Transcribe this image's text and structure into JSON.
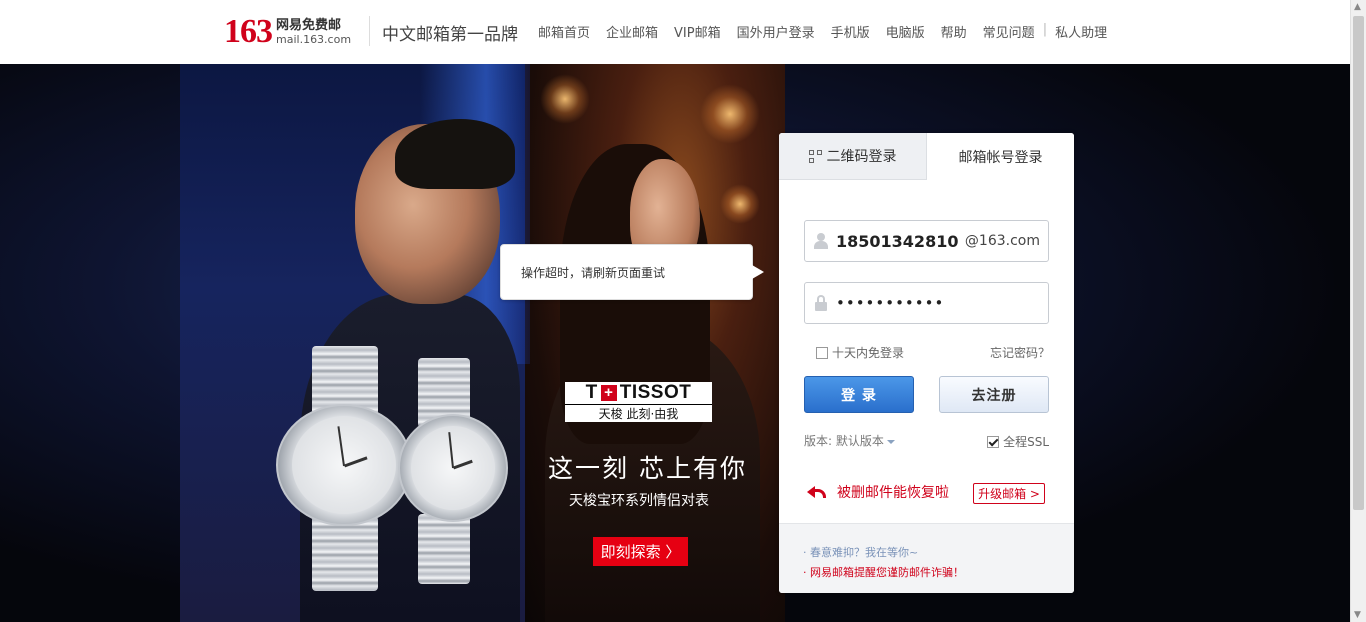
{
  "header": {
    "logo_number": "163",
    "logo_cn": "网易免费邮",
    "logo_en": "mail.163.com",
    "slogan": "中文邮箱第一品牌",
    "nav": [
      "邮箱首页",
      "企业邮箱",
      "VIP邮箱",
      "国外用户登录",
      "手机版",
      "电脑版",
      "帮助",
      "常见问题"
    ],
    "nav_separator": "|",
    "nav_assistant": "私人助理"
  },
  "tooltip": {
    "text": "操作超时，请刷新页面重试"
  },
  "ad": {
    "brand": "TISSOT",
    "brand_letter": "T",
    "brand_cross": "+",
    "brand_tagline": "天梭  此刻·由我",
    "title": "这一刻  芯上有你",
    "subtitle": "天梭宝环系列情侣对表",
    "button": "即刻探索 〉"
  },
  "login": {
    "tab_qr": "二维码登录",
    "tab_account": "邮箱帐号登录",
    "username_value": "18501342810",
    "domain_suffix": "@163.com",
    "password_value": "•••••••••••",
    "remember_label": "十天内免登录",
    "remember_checked": false,
    "forgot_label": "忘记密码？",
    "login_button": "登  录",
    "register_button": "去注册",
    "version_label": "版本: 默认版本",
    "ssl_label": "全程SSL",
    "ssl_checked": true,
    "recover_text": "被删邮件能恢复啦",
    "upgrade_button": "升级邮箱 >",
    "footer_line1": "· 春意难抑？我在等你~",
    "footer_line2": "· 网易邮箱提醒您谨防邮件诈骗！"
  },
  "colors": {
    "brand_red": "#d0021b",
    "login_blue": "#2a6fcc",
    "link_gray": "#555555"
  },
  "icons": [
    "qr-code-icon",
    "user-icon",
    "lock-icon",
    "undo-arrow-icon",
    "chevron-down-icon",
    "tissot-cross-icon"
  ]
}
